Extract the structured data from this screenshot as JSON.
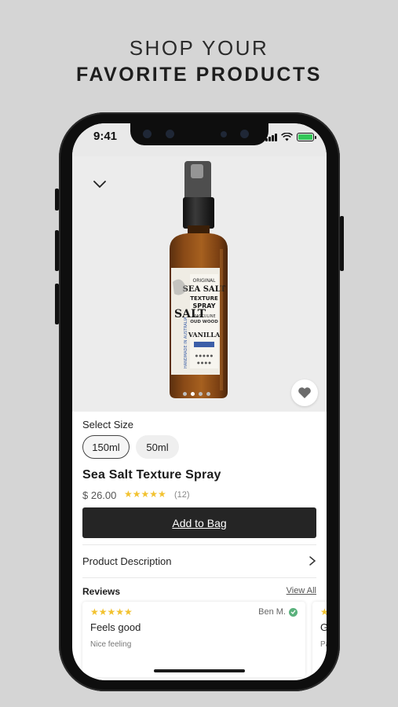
{
  "headline": {
    "line1": "SHOP YOUR",
    "line2": "FAVORITE PRODUCTS"
  },
  "status_bar": {
    "time": "9:41"
  },
  "product": {
    "image_label": {
      "brand": "SEA SALT",
      "line2": "TEXTURE",
      "line3": "SPRAY",
      "scent": "VANILLA",
      "side": "HANDMADE IN AUSTRALIA"
    },
    "select_size_label": "Select Size",
    "sizes": [
      {
        "label": "150ml",
        "selected": true
      },
      {
        "label": "50ml",
        "selected": false
      }
    ],
    "name": "Sea Salt Texture Spray",
    "price": "$ 26.00",
    "rating_stars": "★★★★★",
    "rating_count": "(12)",
    "add_to_bag": "Add to Bag",
    "description_label": "Product Description"
  },
  "reviews": {
    "heading": "Reviews",
    "view_all": "View All",
    "items": [
      {
        "stars": "★★★★★",
        "author": "Ben M.",
        "title": "Feels good",
        "body": "Nice feeling"
      },
      {
        "stars": "★",
        "author": "",
        "title": "Gi",
        "body": "Pa"
      }
    ]
  },
  "colors": {
    "background": "#d5d5d5",
    "button": "#252525",
    "star": "#f2c230",
    "verified": "#5ab17c"
  }
}
